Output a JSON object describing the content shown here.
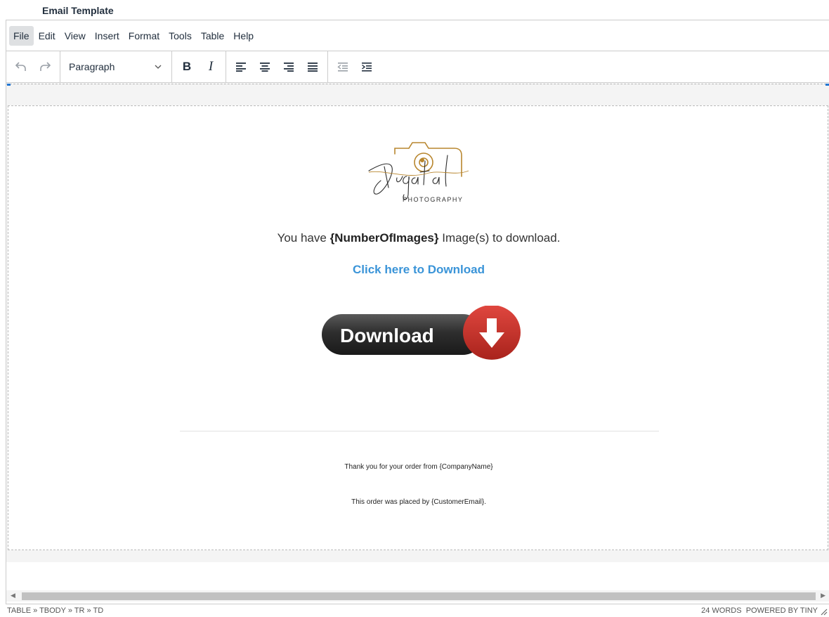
{
  "page_title": "Email Template",
  "menubar": [
    "File",
    "Edit",
    "View",
    "Insert",
    "Format",
    "Tools",
    "Table",
    "Help"
  ],
  "toolbar": {
    "block_format": "Paragraph"
  },
  "email": {
    "logo_script": "Digatal",
    "logo_sub": "PHOTOGRAPHY",
    "message_pre": "You have ",
    "message_token": "{NumberOfImages}",
    "message_post": " Image(s) to download.",
    "link_text": "Click here to Download",
    "button_text": "Download",
    "footer_line1": "Thank you for your order from {CompanyName}",
    "footer_line2": "This order was placed  by {CustomerEmail}."
  },
  "statusbar": {
    "path": "TABLE » TBODY » TR » TD",
    "word_count": "24 WORDS",
    "branding": "POWERED BY TINY"
  },
  "colors": {
    "link": "#3a94d8",
    "selection": "#2276d2",
    "button_dark": "#2b2b2b",
    "button_red": "#c9302c",
    "logo_gold": "#b8862e"
  },
  "icons": [
    "undo-icon",
    "redo-icon",
    "chevron-down-icon",
    "align-left-icon",
    "align-center-icon",
    "align-right-icon",
    "align-justify-icon",
    "outdent-icon",
    "indent-icon",
    "arrow-down-icon",
    "resize-handle-icon"
  ]
}
